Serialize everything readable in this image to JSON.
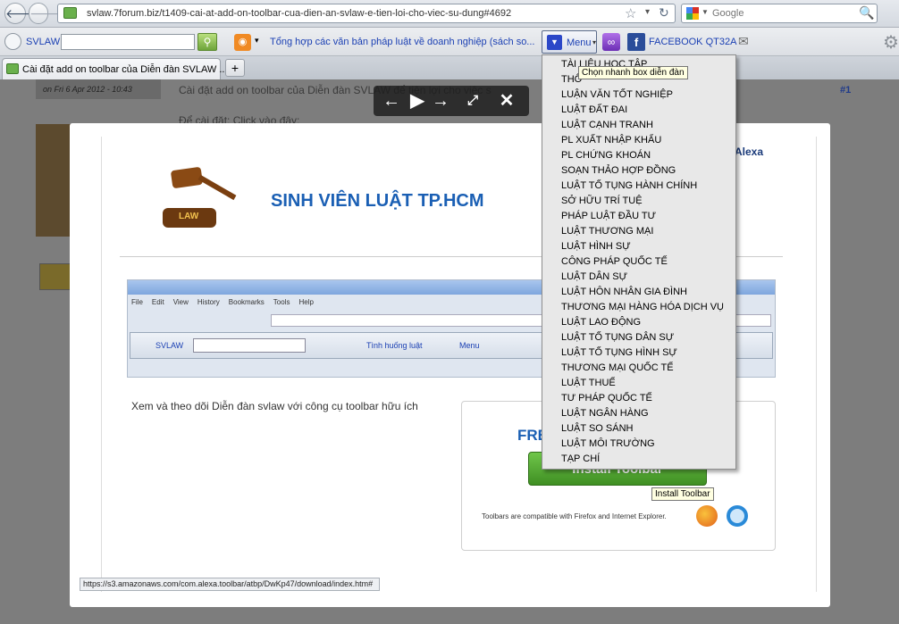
{
  "browser": {
    "back_icon": "back-arrow-icon",
    "url": "svlaw.7forum.biz/t1409-cai-at-add-on-toolbar-cua-dien-an-svlaw-e-tien-loi-cho-viec-su-dung#4692",
    "search_engine": "Google",
    "search_placeholder": "Google"
  },
  "toolbar": {
    "brand": "SVLAW",
    "news_text": "Tổng hợp các văn bản pháp luật về doanh nghiệp (sách so...",
    "menu_label": "Menu",
    "facebook_label": "FACEBOOK QT32A"
  },
  "tab": {
    "title": "Cài đặt add on toolbar của Diễn đàn SVLAW ...",
    "new_tab": "+"
  },
  "post": {
    "date": "on Fri 6 Apr 2012 - 10:43",
    "title": "Cài đặt add on toolbar của Diễn đàn SVLAW để tiện lợi cho việc s",
    "post_no": "#1",
    "line": "Để cài đặt: Click vào đây:"
  },
  "lightbox": {
    "site_title": "SINH VIÊN LUẬT TP.HCM",
    "alexa": "Alexa",
    "gavel_label": "LAW",
    "inner_menu": [
      "File",
      "Edit",
      "View",
      "History",
      "Bookmarks",
      "Tools",
      "Help"
    ],
    "inner_brand": "SVLAW",
    "inner_news": "Tình huống luật",
    "inner_menu_label": "Menu",
    "desc": "Xem và theo dõi Diễn đàn svlaw với công cụ toolbar hữu ích",
    "promo_head": "FRE",
    "install_label": "Install Toolbar",
    "compat_text": "Toolbars are compatible with Firefox and Internet Explorer.",
    "install_tooltip": "Install Toolbar",
    "status_url": "https://s3.amazonaws.com/com.alexa.toolbar/atbp/DwKp47/download/index.htm#"
  },
  "menu": {
    "tooltip": "Chọn nhanh box diễn đàn",
    "items": [
      "TÀI LIỆU HỌC TẬP",
      "THỐ",
      "LUẬN VĂN TỐT NGHIỆP",
      "LUẬT ĐẤT ĐAI",
      "LUẬT CẠNH TRANH",
      "PL XUẤT NHẬP KHẨU",
      "PL CHỨNG KHOÁN",
      "SOẠN THẢO HỢP ĐỒNG",
      "LUẬT TỐ TỤNG HÀNH CHÍNH",
      "SỞ HỮU TRÍ TUỆ",
      "PHÁP LUẬT ĐẦU TƯ",
      "LUẬT THƯƠNG MẠI",
      "LUẬT HÌNH SỰ",
      "CÔNG PHÁP QUỐC TẾ",
      "LUẬT DÂN SỰ",
      "LUẬT HÔN NHÂN GIA ĐÌNH",
      "THƯƠNG MẠI HÀNG HÓA DỊCH VỤ",
      "LUẬT LAO ĐỘNG",
      "LUẬT TỐ TỤNG DÂN SỰ",
      "LUẬT TỐ TỤNG HÌNH SỰ",
      "THƯƠNG MẠI QUỐC TẾ",
      "LUẬT THUẾ",
      "TƯ PHÁP QUỐC TẾ",
      "LUẬT NGÂN HÀNG",
      "LUẬT SO SÁNH",
      "LUẬT MÔI TRƯỜNG",
      "TẠP CHÍ"
    ]
  },
  "colors": {
    "link_blue": "#1a3fb3",
    "install_green": "#4aa02c",
    "site_title_blue": "#1a5fb4"
  }
}
